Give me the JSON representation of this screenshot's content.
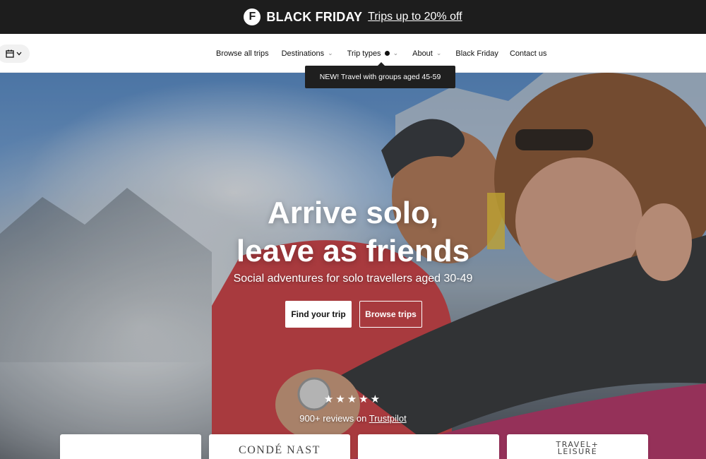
{
  "promo": {
    "logo_letter": "F",
    "title": "BLACK FRIDAY",
    "link": "Trips up to 20% off"
  },
  "nav": {
    "items": [
      {
        "label": "Browse all trips",
        "dropdown": false
      },
      {
        "label": "Destinations",
        "dropdown": true
      },
      {
        "label": "Trip types",
        "dropdown": true,
        "has_dot": true
      },
      {
        "label": "About",
        "dropdown": true
      },
      {
        "label": "Black Friday",
        "dropdown": false
      },
      {
        "label": "Contact us",
        "dropdown": false
      }
    ],
    "tooltip": "NEW! Travel with groups aged 45-59"
  },
  "hero": {
    "title_line1": "Arrive solo,",
    "title_line2": "leave as friends",
    "subtitle": "Social adventures for solo travellers aged 30-49",
    "primary_button": "Find your trip",
    "secondary_button": "Browse trips",
    "stars": "★★★★★",
    "reviews_prefix": "900+ reviews on ",
    "reviews_link": "Trustpilot"
  },
  "press": {
    "logos": [
      "",
      "CONDÉ NAST",
      "",
      "TRAVEL+\nLEISURE"
    ]
  },
  "colors": {
    "promo_bg": "#1d1d1d",
    "tooltip_bg": "#1f1f1f",
    "accent_white": "#ffffff"
  }
}
